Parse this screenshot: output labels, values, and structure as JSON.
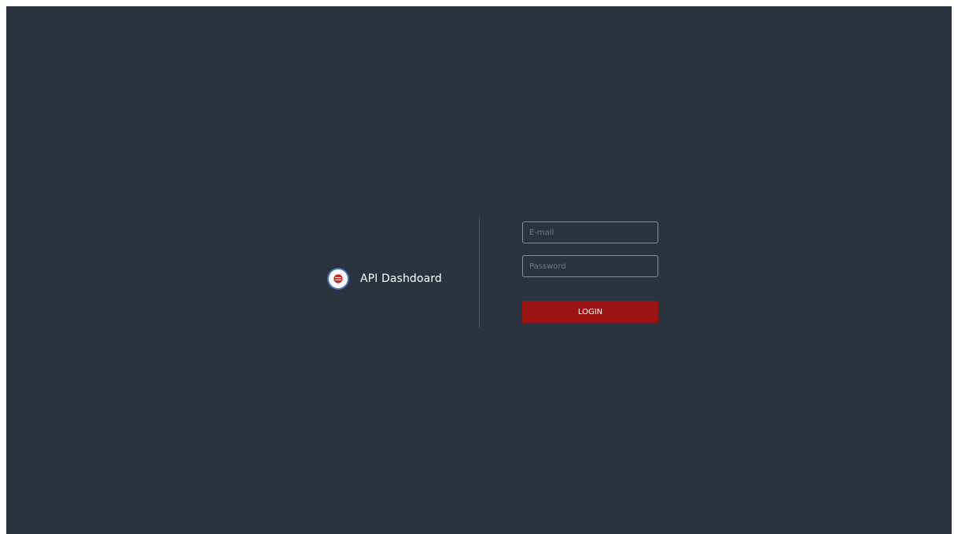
{
  "brand": {
    "title": "API Dashdoard",
    "logo_icon": "flower-badge-icon",
    "logo_colors": {
      "ring": "#4a6fb5",
      "petals": "#ffffff",
      "center": "#c62828"
    }
  },
  "form": {
    "email_placeholder": "E-mail",
    "email_value": "",
    "password_placeholder": "Password",
    "password_value": "",
    "login_label": "LOGIN"
  },
  "colors": {
    "background": "#2b343e",
    "divider": "#4a535d",
    "input_border": "#8a9199",
    "button": "#9b1414",
    "text": "#ffffff"
  }
}
